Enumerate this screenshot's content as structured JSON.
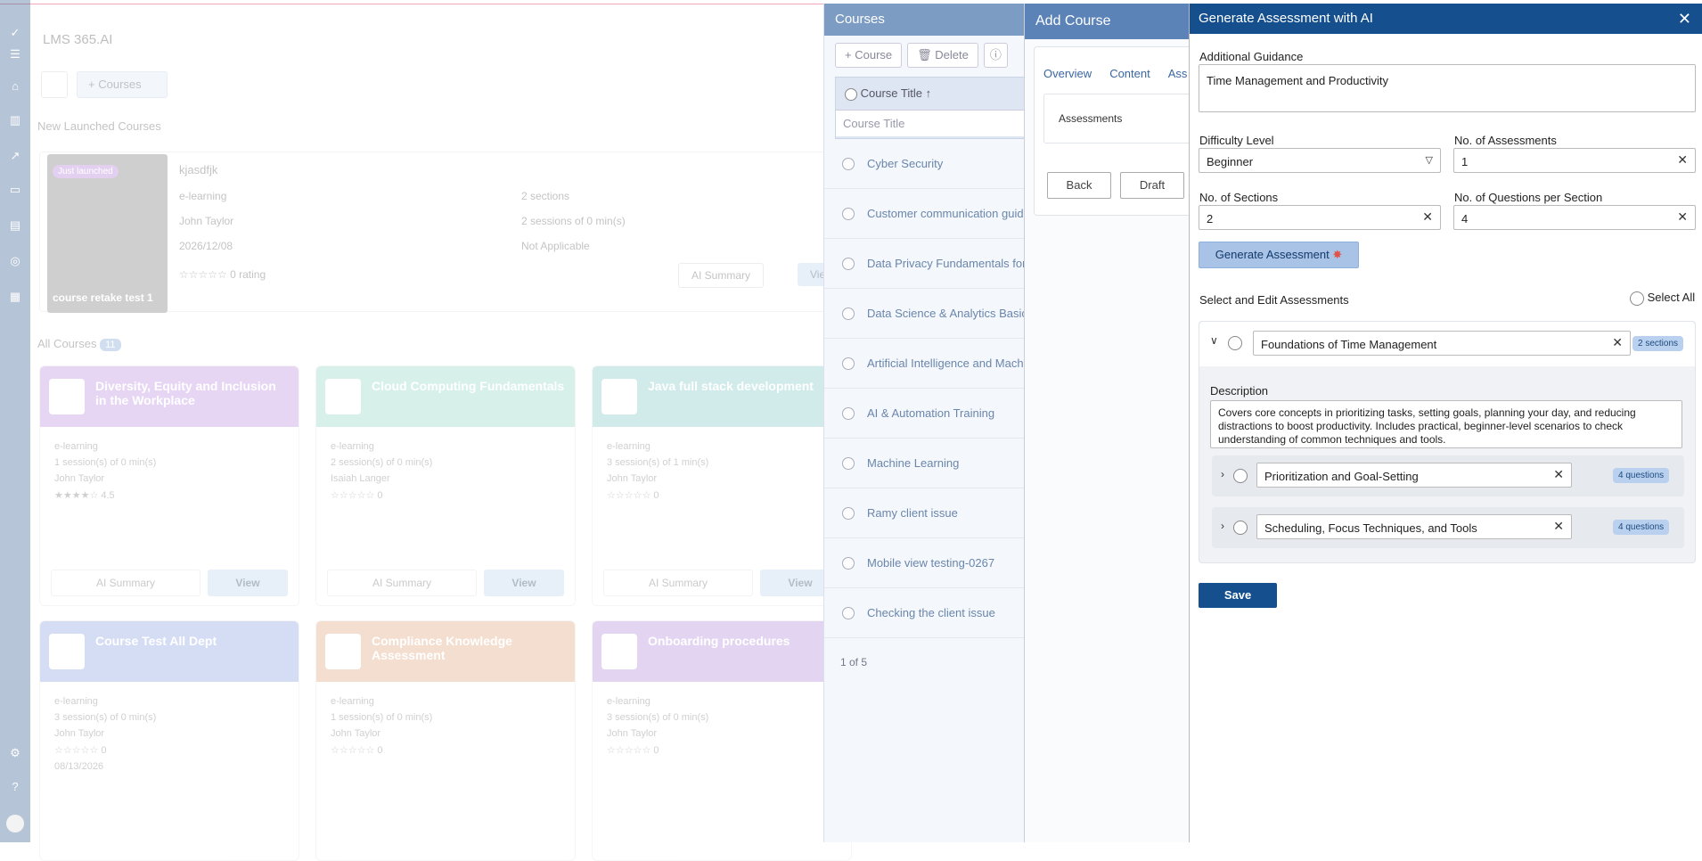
{
  "brand": "LMS 365.AI",
  "bg": {
    "courses_btn": "Courses",
    "new_launched": "New Launched Courses",
    "launched": {
      "tag": "Just launched",
      "thumb_title": "course retake test 1",
      "title": "kjasdfjk",
      "type": "e-learning",
      "author": "John Taylor",
      "date": "2026/12/08",
      "sections": "2 sections",
      "sessions": "2 sessions of 0 min(s)",
      "applicable": "Not Applicable",
      "rating": "0 rating",
      "ai_summary": "AI Summary",
      "view": "View"
    },
    "all_courses": "All Courses",
    "all_count": "11",
    "cards": [
      {
        "title": "Diversity, Equity and Inclusion in the Workplace",
        "color": "#b98ce0",
        "type": "e-learning",
        "sessions": "1 session(s) of 0 min(s)",
        "author": "John Taylor",
        "rating": "4.5"
      },
      {
        "title": "Cloud Computing Fundamentals",
        "color": "#8fd9c6",
        "type": "e-learning",
        "sessions": "2 session(s) of 0 min(s)",
        "author": "Isaiah Langer",
        "rating": "0"
      },
      {
        "title": "Java full stack development",
        "color": "#7cc8c2",
        "type": "e-learning",
        "sessions": "3 session(s) of 1 min(s)",
        "author": "John Taylor",
        "rating": "0"
      },
      {
        "title": "Course Test All Dept",
        "color": "#8aa1e3",
        "type": "e-learning",
        "sessions": "3 session(s) of 0 min(s)",
        "author": "John Taylor",
        "rating": "0"
      },
      {
        "title": "Compliance Knowledge Assessment",
        "color": "#e0a27a",
        "type": "e-learning",
        "sessions": "1 session(s) of 0 min(s)",
        "author": "John Taylor",
        "rating": "0"
      },
      {
        "title": "Onboarding procedures",
        "color": "#b28ad8",
        "type": "e-learning",
        "sessions": "3 session(s) of 0 min(s)",
        "author": "John Taylor",
        "rating": "0"
      }
    ],
    "card_date": "08/13/2026",
    "ai_summary": "AI Summary",
    "view": "View"
  },
  "courses_panel": {
    "title": "Courses",
    "add_btn": "Course",
    "delete_btn": "Delete",
    "col_header": "Course Title",
    "filter_placeholder": "Course Title",
    "rows": [
      "Cyber Security",
      "Customer communication guide",
      "Data Privacy Fundamentals for Teams",
      "Data Science & Analytics Basics",
      "Artificial Intelligence and Machine",
      "AI & Automation Training",
      "Machine Learning",
      "Ramy client issue",
      "Mobile view testing-0267",
      "Checking the client issue"
    ],
    "pager": "1 of 5"
  },
  "add_course": {
    "title": "Add Course",
    "tabs": [
      "Overview",
      "Content",
      "Ass"
    ],
    "assessments": "Assessments",
    "back": "Back",
    "draft": "Draft"
  },
  "gen": {
    "title": "Generate Assessment with AI",
    "guidance_label": "Additional Guidance",
    "guidance_value": "Time Management and Productivity",
    "difficulty_label": "Difficulty Level",
    "difficulty_value": "Beginner",
    "num_assess_label": "No. of Assessments",
    "num_assess_value": "1",
    "num_sections_label": "No. of Sections",
    "num_sections_value": "2",
    "num_q_label": "No. of Questions per Section",
    "num_q_value": "4",
    "generate_btn": "Generate Assessment",
    "select_edit": "Select and Edit Assessments",
    "select_all": "Select All",
    "assessment_title": "Foundations of Time Management",
    "assessment_badge": "2 sections",
    "description_label": "Description",
    "description": "Covers core concepts in prioritizing tasks, setting goals, planning your day, and reducing distractions to boost productivity. Includes practical, beginner-level scenarios to check understanding of common techniques and tools.",
    "sections": [
      {
        "title": "Prioritization and Goal-Setting",
        "badge": "4 questions"
      },
      {
        "title": "Scheduling, Focus Techniques, and Tools",
        "badge": "4 questions"
      }
    ],
    "save": "Save"
  }
}
